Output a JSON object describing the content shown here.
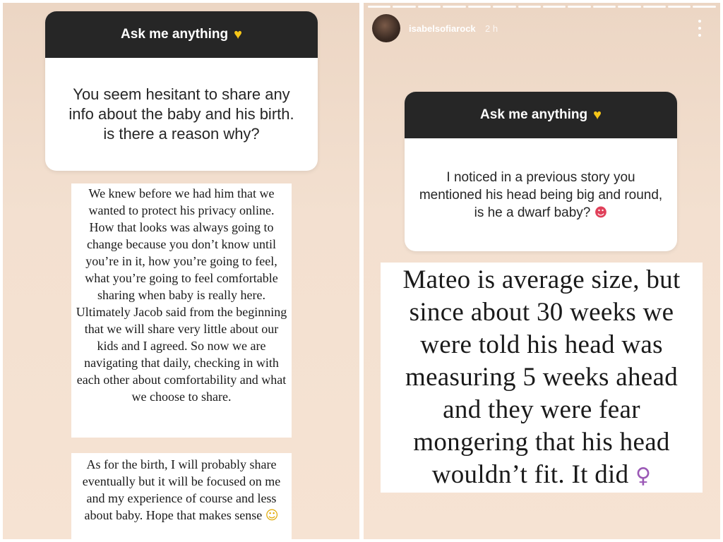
{
  "left_story": {
    "question": {
      "header": "Ask me anything",
      "header_icon": "yellow-heart-icon",
      "text": "You seem hesitant to share any info about the baby and his birth. is there a reason why?"
    },
    "answer_1": "We knew before we had him that we wanted to protect his privacy online. How that looks was always going to change because you don’t know until you’re in it, how you’re going to feel, what you’re going to feel comfortable sharing when baby is really here. Ultimately Jacob said from the beginning that we will share very little about our kids and I agreed. So now we are navigating that daily, checking in with each other about comfortability and what we choose to share.",
    "answer_2": "As for the birth, I will probably share eventually but it will be focused on me and my experience of course and less about baby. Hope that makes sense",
    "answer_2_icon": "slightly-smiling-face-icon"
  },
  "right_story": {
    "username": "isabelsofiarock",
    "timestamp": "2 h",
    "menu_icon": "more-vertical-icon",
    "question": {
      "header": "Ask me anything",
      "header_icon": "yellow-heart-icon",
      "text": "I noticed in a previous story you mentioned his head being big and round, is he a dwarf baby?",
      "text_icon": "heart-eyes-icon"
    },
    "answer": "Mateo is average size, but since about 30 weeks we were told his head was measuring 5 weeks ahead and they were fear mongering that his head wouldn’t fit. It did",
    "answer_icon": "shrugging-woman-icon"
  },
  "colors": {
    "story_background": "#f3e0d0",
    "question_header": "#262626",
    "heart": "#f5c518"
  }
}
